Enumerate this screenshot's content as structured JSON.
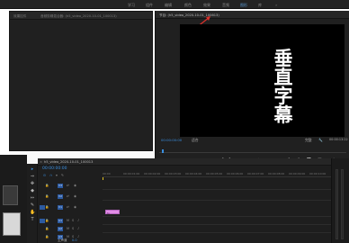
{
  "menu": {
    "workspaces": [
      "学习",
      "组件",
      "编辑",
      "颜色",
      "效果",
      "音频",
      "图形",
      "库"
    ],
    "active_index": 6
  },
  "source_panel": {
    "tabs": [
      "效果控件",
      "音频剪辑混合器: (h5_video_2020-10-01_100013)"
    ]
  },
  "program_panel": {
    "tab_title": "节目: (h5_video_2020-10-01_100013)",
    "subtitle_chars": [
      "垂",
      "直",
      "字",
      "幕"
    ],
    "timecode_left": "00:00:00:00",
    "fit_label": "适合",
    "quality_label": "完整",
    "timecode_right": "00:00:13:22"
  },
  "timeline": {
    "sequence_tab": "h5_video_2020-10-01_100013",
    "timecode": "00:00:00:00",
    "ruler_ticks": [
      "00:00",
      "00:00:01:00",
      "00:00:02:00",
      "00:00:03:00",
      "00:00:04:00",
      "00:00:05:00",
      "00:00:06:00",
      "00:00:07:00",
      "00:00:08:00",
      "00:00:09:00",
      "00:00:10:00"
    ],
    "tracks": [
      "V3",
      "V2",
      "V1",
      "A1",
      "A2",
      "A3"
    ],
    "master_label": "主声道",
    "master_value": "0.0",
    "clip_label": "fx"
  },
  "colors": {
    "accent": "#3a8fe0",
    "clip": "#e18de6",
    "annotation_arrow": "#d9302b"
  }
}
